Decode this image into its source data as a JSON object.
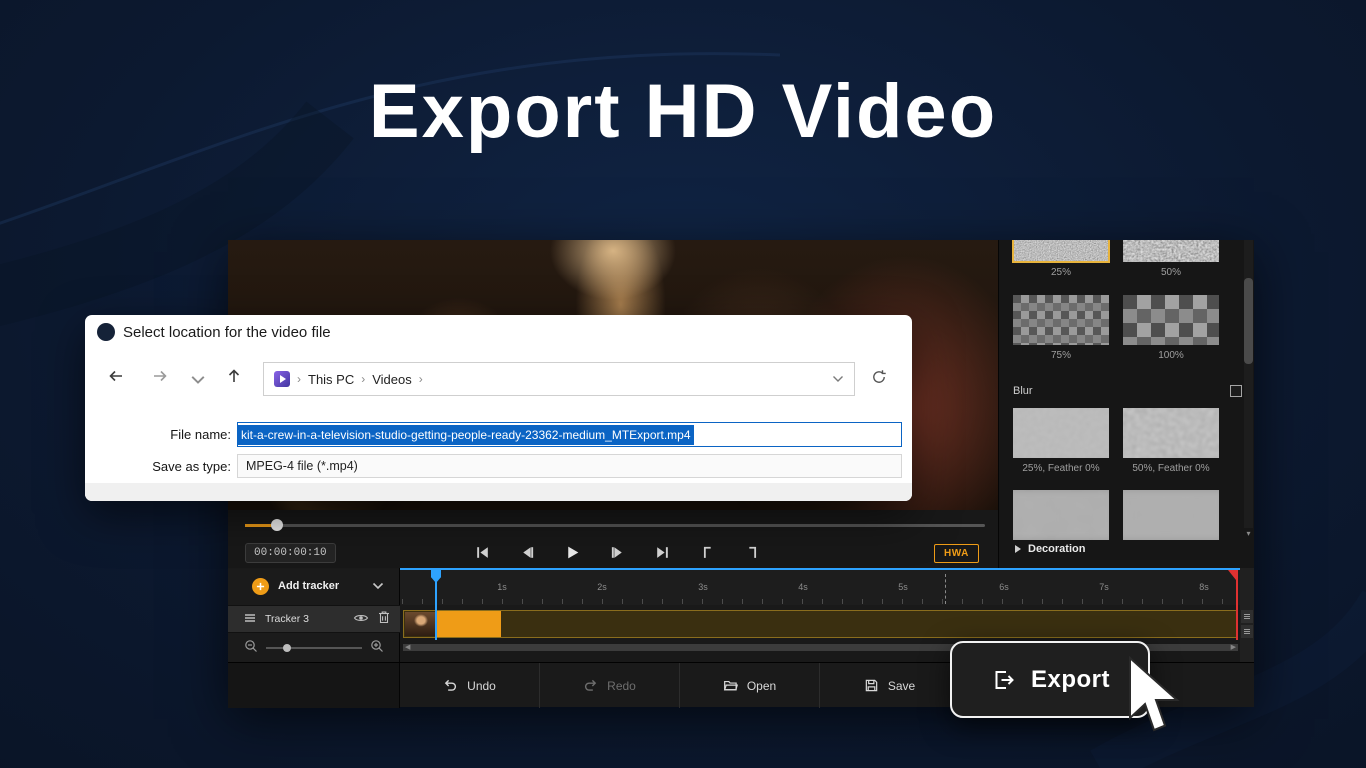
{
  "hero": {
    "title": "Export HD Video"
  },
  "dialog": {
    "title": "Select location for the video file",
    "breadcrumbs": [
      "This PC",
      "Videos"
    ],
    "file_name_label": "File name:",
    "file_name_value": "kit-a-crew-in-a-television-studio-getting-people-ready-23362-medium_MTExport.mp4",
    "save_as_type_label": "Save as type:",
    "save_as_type_value": "MPEG-4 file (*.mp4)"
  },
  "player": {
    "timecode": "00:00:00:10",
    "hwa_badge": "HWA"
  },
  "effects": {
    "mosaic_labels": [
      "25%",
      "50%",
      "75%",
      "100%"
    ],
    "blur_header": "Blur",
    "blur_labels": [
      "25%, Feather 0%",
      "50%, Feather 0%"
    ],
    "decoration_header": "Decoration"
  },
  "timeline": {
    "add_tracker_label": "Add tracker",
    "tracker_name": "Tracker 3",
    "ruler_ticks": [
      "1s",
      "2s",
      "3s",
      "4s",
      "5s",
      "6s",
      "7s",
      "8s"
    ]
  },
  "toolbar": {
    "undo_label": "Undo",
    "redo_label": "Redo",
    "open_label": "Open",
    "save_label": "Save"
  },
  "export_button_label": "Export",
  "colors": {
    "accent_orange": "#ef9c17",
    "selection_blue": "#0b64c4",
    "playhead_blue": "#2ea3ff",
    "background_navy": "#0c1930"
  }
}
